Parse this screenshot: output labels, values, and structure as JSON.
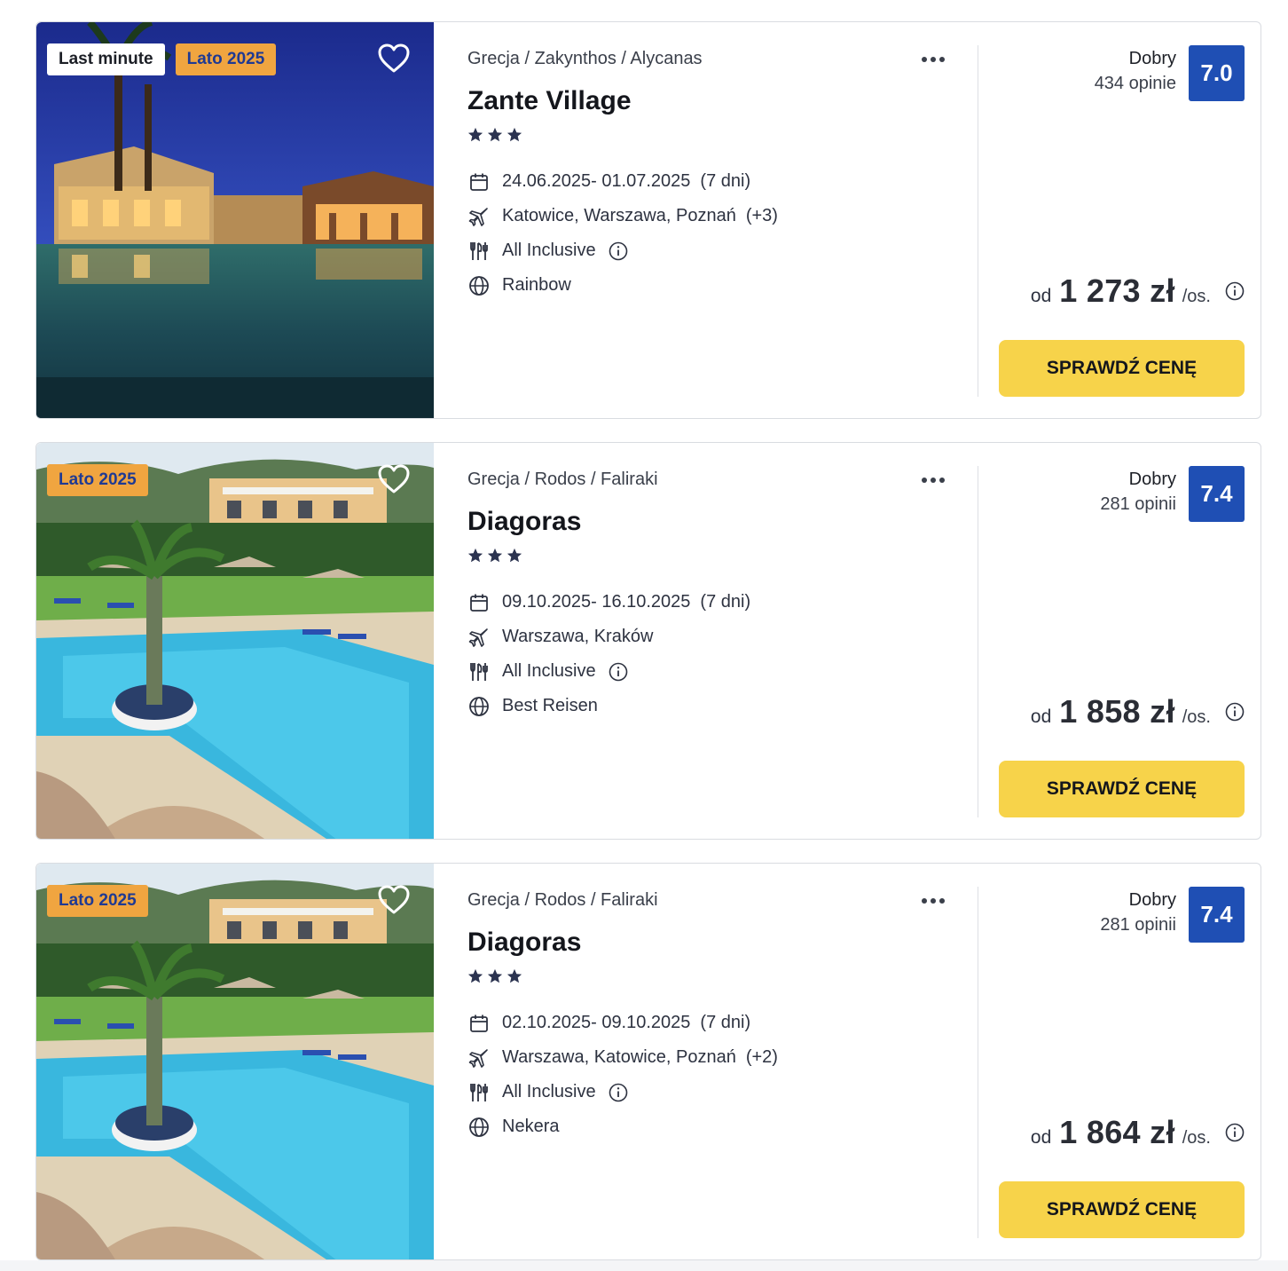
{
  "offers": [
    {
      "badges": [
        "Last minute",
        "Lato 2025"
      ],
      "breadcrumb": "Grecja / Zakynthos / Alycanas",
      "name": "Zante Village",
      "stars": 3,
      "dates": "24.06.2025- 01.07.2025",
      "duration": "(7 dni)",
      "departures": "Katowice, Warszawa, Poznań",
      "departures_more": "(+3)",
      "board": "All Inclusive",
      "operator": "Rainbow",
      "rating_word": "Dobry",
      "reviews": "434 opinie",
      "score": "7.0",
      "price_from": "od",
      "price": "1 273 zł",
      "price_unit": "/os.",
      "cta": "SPRAWDŹ CENĘ",
      "photo": "hotel-pool-night"
    },
    {
      "badges": [
        "Lato 2025"
      ],
      "breadcrumb": "Grecja / Rodos / Faliraki",
      "name": "Diagoras",
      "stars": 3,
      "dates": "09.10.2025- 16.10.2025",
      "duration": "(7 dni)",
      "departures": "Warszawa, Kraków",
      "departures_more": "",
      "board": "All Inclusive",
      "operator": "Best Reisen",
      "rating_word": "Dobry",
      "reviews": "281 opinii",
      "score": "7.4",
      "price_from": "od",
      "price": "1 858 zł",
      "price_unit": "/os.",
      "cta": "SPRAWDŹ CENĘ",
      "photo": "hotel-pool-day"
    },
    {
      "badges": [
        "Lato 2025"
      ],
      "breadcrumb": "Grecja / Rodos / Faliraki",
      "name": "Diagoras",
      "stars": 3,
      "dates": "02.10.2025- 09.10.2025",
      "duration": "(7 dni)",
      "departures": "Warszawa, Katowice, Poznań",
      "departures_more": "(+2)",
      "board": "All Inclusive",
      "operator": "Nekera",
      "rating_word": "Dobry",
      "reviews": "281 opinii",
      "score": "7.4",
      "price_from": "od",
      "price": "1 864 zł",
      "price_unit": "/os.",
      "cta": "SPRAWDŹ CENĘ",
      "photo": "hotel-pool-day"
    }
  ],
  "colors": {
    "badge_orange": "#f0a540",
    "score_blue": "#1f4fb4",
    "cta_yellow": "#f7d34a",
    "star": "#2b3350"
  },
  "icons": {
    "favorite": "heart-icon",
    "more": "more-dots-icon",
    "dates": "calendar-icon",
    "departures": "plane-icon",
    "board": "cutlery-icon",
    "operator": "globe-icon",
    "info": "info-icon",
    "rating": "star-icon"
  }
}
